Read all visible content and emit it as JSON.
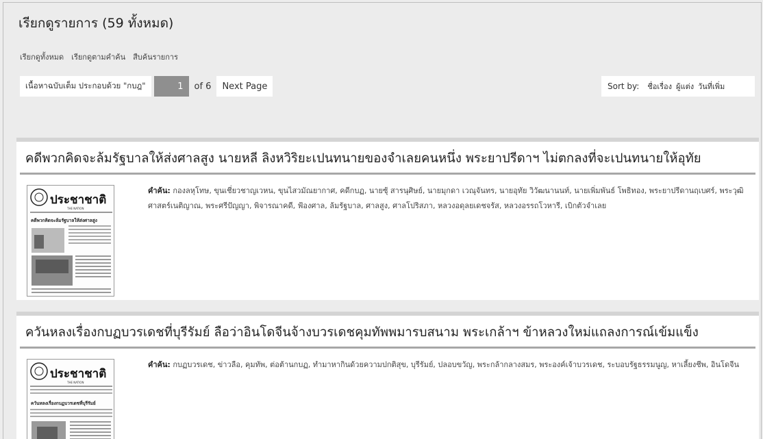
{
  "header": {
    "title": "เรียกดูรายการ (59 ทั้งหมด)",
    "links": [
      "เรียกดูทั้งหมด",
      "เรียกดูตามคำค้น",
      "สืบค้นรายการ"
    ]
  },
  "pager": {
    "filter_label": "เนื้อหาฉบับเต็ม ประกอบด้วย \"กบฎ\"",
    "current_page": "1",
    "of_text": "of 6",
    "next_label": "Next Page"
  },
  "sort": {
    "label": "Sort by:",
    "options": [
      "ชื่อเรื่อง",
      "ผู้แต่ง",
      "วันที่เพิ่ม"
    ]
  },
  "items": [
    {
      "title": "คดีพวกคิดจะล้มรัฐบาลให้ส่งศาลสูง นายหลี ลิงหวิริยะเปนทนายของจำเลยคนหนึ่ง พระยาปรีดาฯ ไม่ตกลงที่จะเปนทนายให้อุทัย",
      "keywords_label": "คำค้น:",
      "keywords": "กองลหุโทษ, ขุนเชี่ยวชาญเวหน, ขุนไสวมัณยากาศ, คดีกบฏ, นายซุ้ สารนุศิษย์, นายมุกดา เวณุจันทร, นายอุทัย วิวัฒนานนท์, นายเพิ่มพันธ์ โพธิทอง, พระยาปรีดานฤเบศร์, พระวุฒิศาสตร์เนติญาณ, พระศรีปัญญา, พิจารณาคดี, ฟ้องศาล, ล้มรัฐบาล, ศาลสูง, ศาลโปริสภา, หลวงอดุลยเดชจรัส, หลวงอรรถโวหารี, เบิกตัวจำเลย",
      "thumb": {
        "masthead": "ประชาชาติ",
        "sub": "THE NATION",
        "headline": "คดีพวกคิดจะล้มรัฐบาลให้ส่งศาลสูง"
      }
    },
    {
      "title": "ควันหลงเรื่องกบฏบวรเดชที่บุรีรัมย์ ลือว่าอินโดจีนจ้างบวรเดชคุมทัพพมารบสนาม พระเกล้าฯ ข้าหลวงใหม่แถลงการณ์เข้มแข็ง",
      "keywords_label": "คำค้น:",
      "keywords": "กบฏบวรเดช, ข่าวลือ, คุมทัพ, ต่อต้านกบฏ, ทำมาหากินด้วยความปกติสุข, บุรีรัมย์, ปลอบขวัญ, พระกล้ากลางสมร, พระองค์เจ้าบวรเดช, ระบอบรัฐธรรมนูญ, หาเลี้ยงชีพ, อินโดจีน",
      "thumb": {
        "masthead": "ประชาชาติ",
        "sub": "THE NATION",
        "headline": "ควันหลงเรื่องกบฏบวรเดชที่บุรีรัมย์"
      }
    }
  ]
}
